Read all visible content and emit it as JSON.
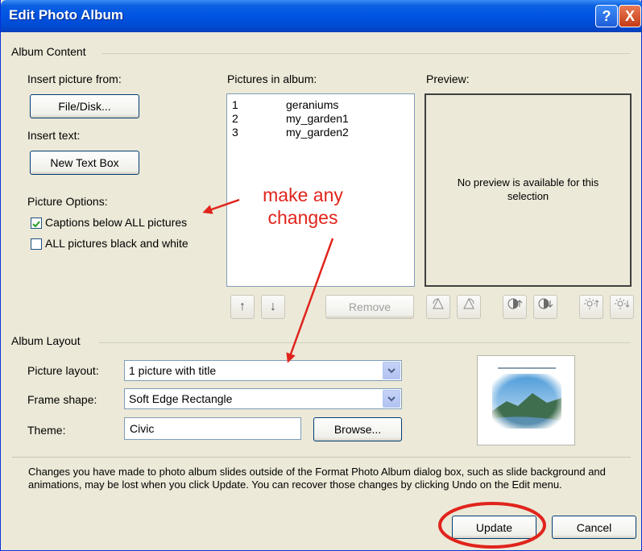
{
  "window": {
    "title": "Edit Photo Album",
    "help_glyph": "?",
    "close_glyph": "X"
  },
  "album_content": {
    "group_label": "Album Content",
    "insert_picture_label": "Insert picture from:",
    "file_disk_button": "File/Disk...",
    "insert_text_label": "Insert text:",
    "new_text_box_button": "New Text Box",
    "picture_options_label": "Picture Options:",
    "captions_checkbox": {
      "label": "Captions below ALL pictures",
      "checked": true
    },
    "black_white_checkbox": {
      "label": "ALL pictures black and white",
      "checked": false
    }
  },
  "pictures": {
    "label": "Pictures in album:",
    "items": [
      {
        "num": "1",
        "name": "geraniums"
      },
      {
        "num": "2",
        "name": "my_garden1"
      },
      {
        "num": "3",
        "name": "my_garden2"
      }
    ],
    "move_up_glyph": "↑",
    "move_down_glyph": "↓",
    "remove_button": "Remove"
  },
  "preview": {
    "label": "Preview:",
    "message": "No preview is available for this selection"
  },
  "album_layout": {
    "group_label": "Album Layout",
    "picture_layout_label": "Picture layout:",
    "picture_layout_value": "1 picture with title",
    "frame_shape_label": "Frame shape:",
    "frame_shape_value": "Soft Edge Rectangle",
    "theme_label": "Theme:",
    "theme_value": "Civic",
    "browse_button": "Browse..."
  },
  "footer": {
    "notice": "Changes you have made to photo album slides outside of the Format Photo Album dialog box, such as slide background and animations, may be lost when you click Update. You can recover those changes by clicking Undo on the Edit menu.",
    "update_button": "Update",
    "cancel_button": "Cancel"
  },
  "annotations": {
    "callout_text_line1": "make any",
    "callout_text_line2": "changes",
    "color": "#e0241c"
  },
  "colors": {
    "title_bar": "#0054e3",
    "dialog_bg": "#ece9d8",
    "annotation_red": "#e0241c"
  }
}
